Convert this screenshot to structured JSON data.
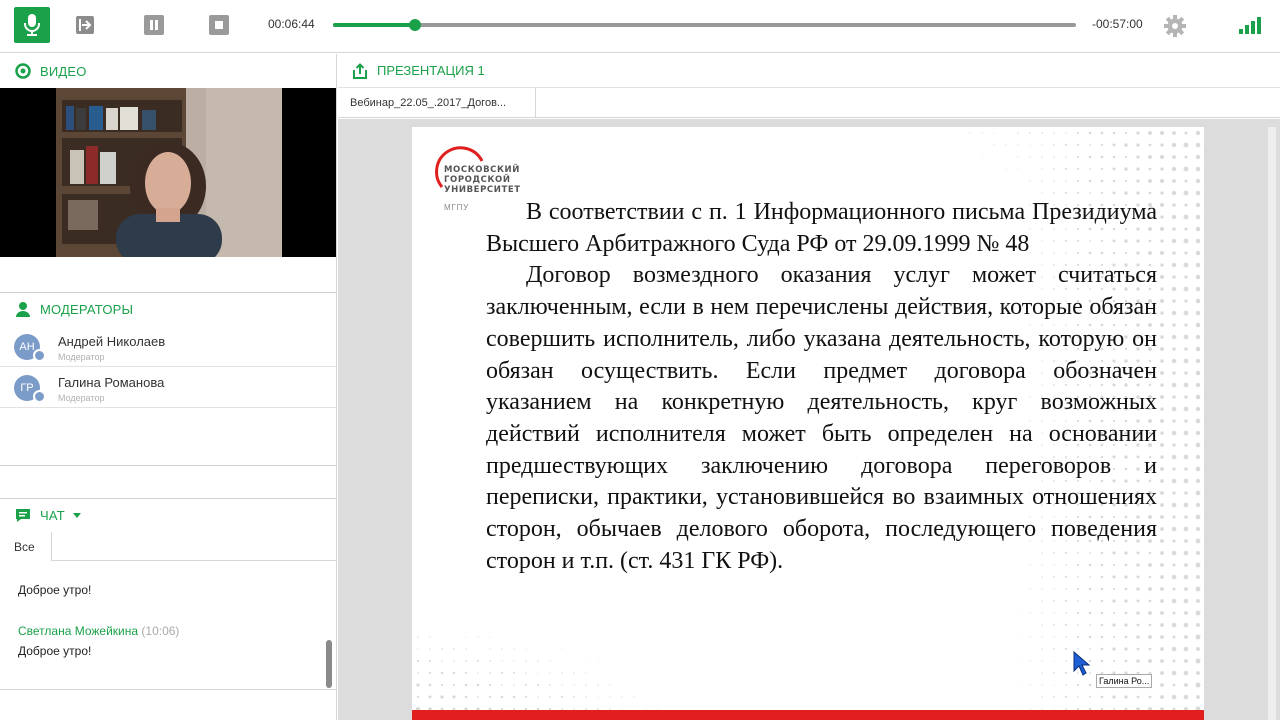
{
  "toolbar": {
    "time_elapsed": "00:06:44",
    "time_remaining": "-00:57:00",
    "progress": 0.11
  },
  "video": {
    "title": "ВИДЕО"
  },
  "moderators": {
    "title": "МОДЕРАТОРЫ",
    "items": [
      {
        "initials": "АН",
        "name": "Андрей Николаев",
        "role": "Модератор"
      },
      {
        "initials": "ГР",
        "name": "Галина Романова",
        "role": "Модератор"
      }
    ]
  },
  "chat": {
    "title": "ЧАТ",
    "tab_all": "Все",
    "messages": [
      {
        "author": "",
        "time": "",
        "text": "Доброе утро!"
      },
      {
        "author": "Светлана Можейкина",
        "time": "(10:06)",
        "text": "Доброе утро!"
      }
    ]
  },
  "presentation": {
    "title": "ПРЕЗЕНТАЦИЯ 1",
    "file_tab": "Вебинар_22.05_.2017_Догов...",
    "logo": {
      "line1": "МОСКОВСКИЙ",
      "line2": "ГОРОДСКОЙ",
      "line3": "УНИВЕРСИТЕТ",
      "sub": "МГПУ"
    },
    "paragraph1": "В соответствии с п. 1 Информационного письма Президиума Высшего Арбитражного Суда РФ от 29.09.1999 № 48",
    "paragraph2": "Договор возмездного оказания услуг может считаться заключенным, если в нем перечислены действия, которые обязан совершить исполнитель, либо указана деятельность, которую он обязан осуществить. Если предмет договора обозначен указанием на конкретную деятельность, круг возможных действий исполнителя может быть определен на основании предшествующих заключению договора переговоров и переписки, практики, установившейся во взаимных отношениях сторон, обычаев делового оборота, последующего поведения сторон и т.п. (ст. 431 ГК РФ).",
    "pointer_label": "Галина Ро..."
  },
  "colors": {
    "accent": "#1aa14a",
    "slide_bar": "#e21f1f",
    "avatar": "#7b9cc8"
  }
}
